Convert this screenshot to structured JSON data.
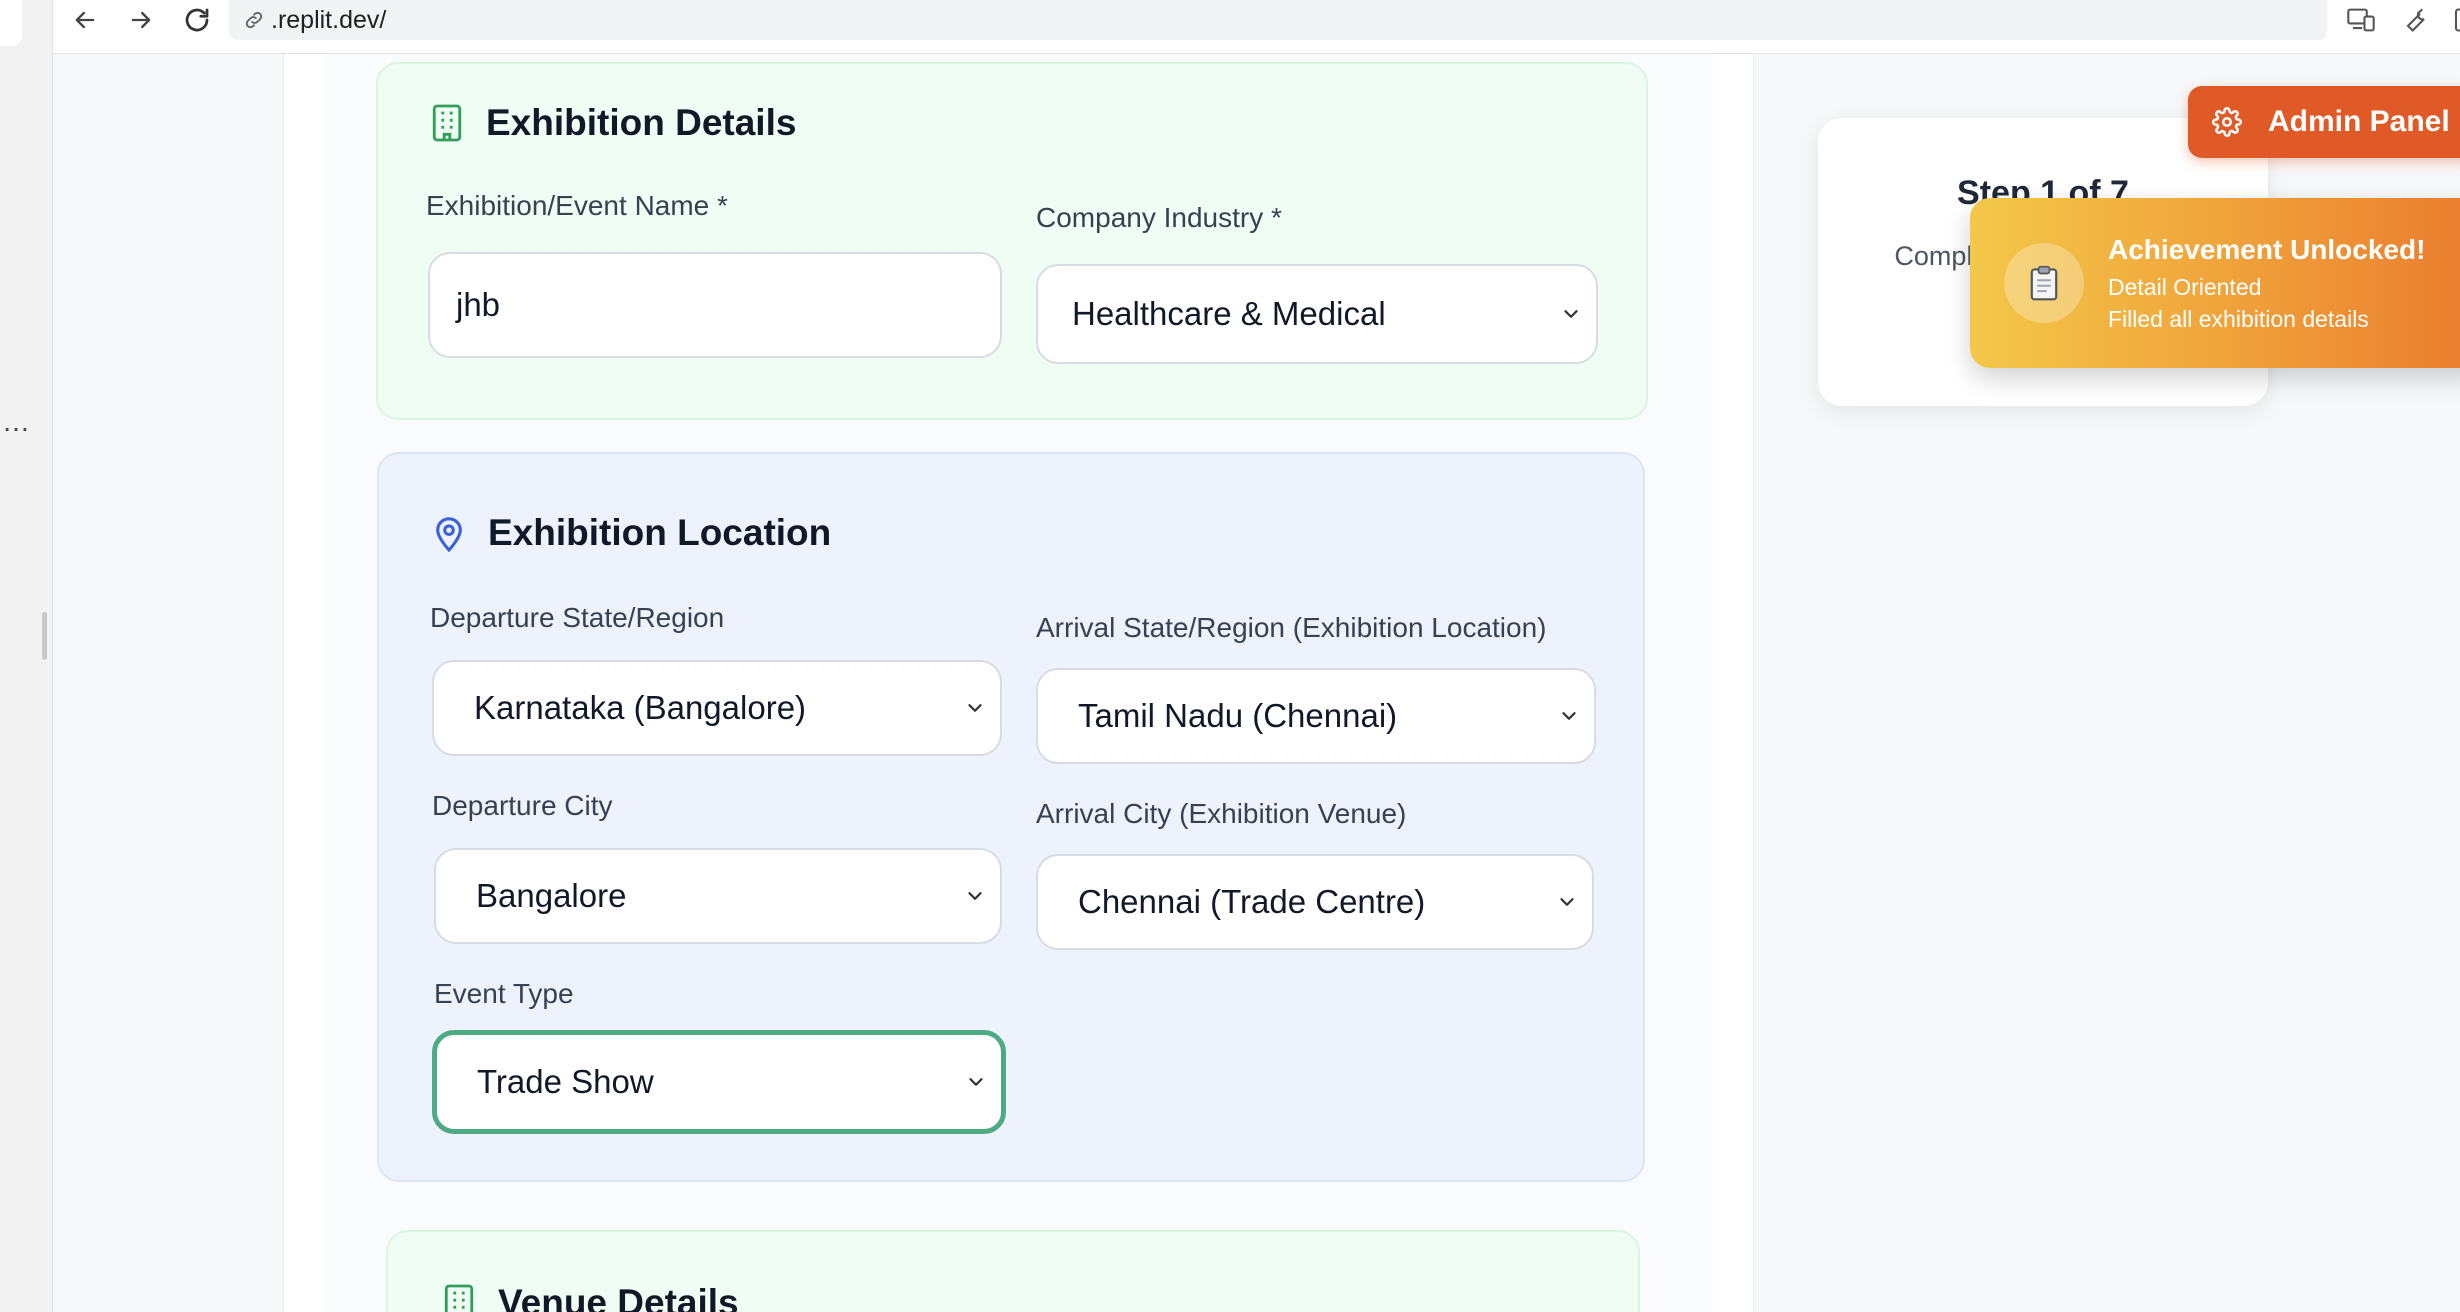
{
  "browser": {
    "url": ".replit.dev/"
  },
  "exhibition_details": {
    "title": "Exhibition Details",
    "event_name_label": "Exhibition/Event Name *",
    "event_name_value": "jhb",
    "industry_label": "Company Industry *",
    "industry_value": "Healthcare & Medical"
  },
  "exhibition_location": {
    "title": "Exhibition Location",
    "departure_state_label": "Departure State/Region",
    "departure_state_value": "Karnataka (Bangalore)",
    "arrival_state_label": "Arrival State/Region (Exhibition Location)",
    "arrival_state_value": "Tamil Nadu (Chennai)",
    "departure_city_label": "Departure City",
    "departure_city_value": "Bangalore",
    "arrival_city_label": "Arrival City (Exhibition Venue)",
    "arrival_city_value": "Chennai (Trade Centre)",
    "event_type_label": "Event Type",
    "event_type_value": "Trade Show"
  },
  "venue_details": {
    "title": "Venue Details"
  },
  "step_card": {
    "title": "Step 1 of 7",
    "text": "Complete your c... dow..."
  },
  "admin_button": {
    "label": "Admin Panel"
  },
  "achievement_toast": {
    "title": "Achievement Unlocked!",
    "name": "Detail Oriented",
    "description": "Filled all exhibition details"
  },
  "colors": {
    "green_section_bg": "#f0fdf4",
    "blue_section_bg": "#eef2fc",
    "focus_border": "#4dab84",
    "admin_orange": "#df5a26",
    "toast_gradient_start": "#f3c84a",
    "toast_gradient_end": "#ea7a2e"
  }
}
